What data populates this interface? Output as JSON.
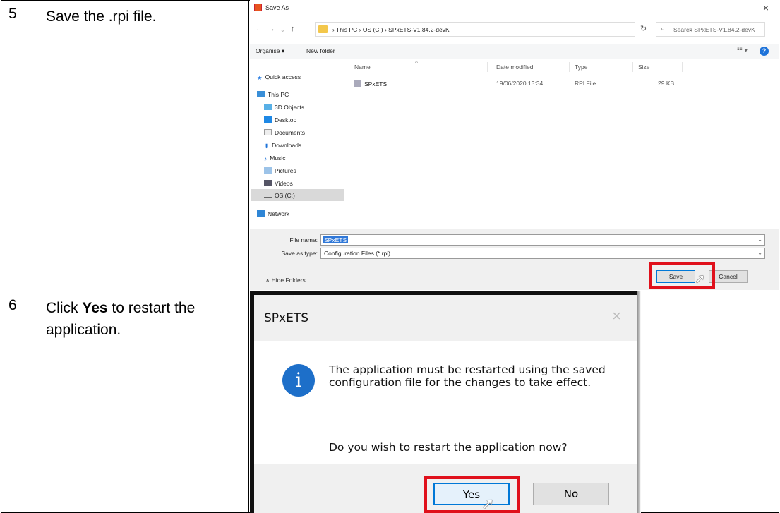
{
  "rows": [
    {
      "number": "5",
      "instruction": "Save the .rpi file."
    },
    {
      "number": "6",
      "instruction_prefix": "Click ",
      "instruction_bold": "Yes",
      "instruction_suffix": " to restart the application."
    }
  ],
  "save_dialog": {
    "title": "Save As",
    "close_glyph": "×",
    "breadcrumbs": "› This PC › OS (C:) › SPxETS-V1.84.2-devK",
    "search_placeholder": "Search SPxETS-V1.84.2-devK",
    "organise": "Organise ▾",
    "new_folder": "New folder",
    "nav_items": [
      "Quick access",
      "This PC",
      "3D Objects",
      "Desktop",
      "Documents",
      "Downloads",
      "Music",
      "Pictures",
      "Videos",
      "OS (C:)",
      "Network"
    ],
    "columns": {
      "name": "Name",
      "date": "Date modified",
      "type": "Type",
      "size": "Size"
    },
    "files": [
      {
        "name": "SPxETS",
        "date": "19/06/2020 13:34",
        "type": "RPI File",
        "size": "29 KB"
      }
    ],
    "file_name_label": "File name:",
    "file_name_value": "SPxETS",
    "save_type_label": "Save as type:",
    "save_type_value": "Configuration Files (*.rpi)",
    "hide_folders": "∧  Hide Folders",
    "save_label": "Save",
    "cancel_label": "Cancel",
    "highlight_color": "#e0101b"
  },
  "confirm_dialog": {
    "title": "SPxETS",
    "close_glyph": "×",
    "info_glyph": "i",
    "message": "The application must be restarted using the saved configuration file for the changes to take effect.",
    "question": "Do you wish to restart the application now?",
    "yes_label": "Yes",
    "no_label": "No"
  }
}
